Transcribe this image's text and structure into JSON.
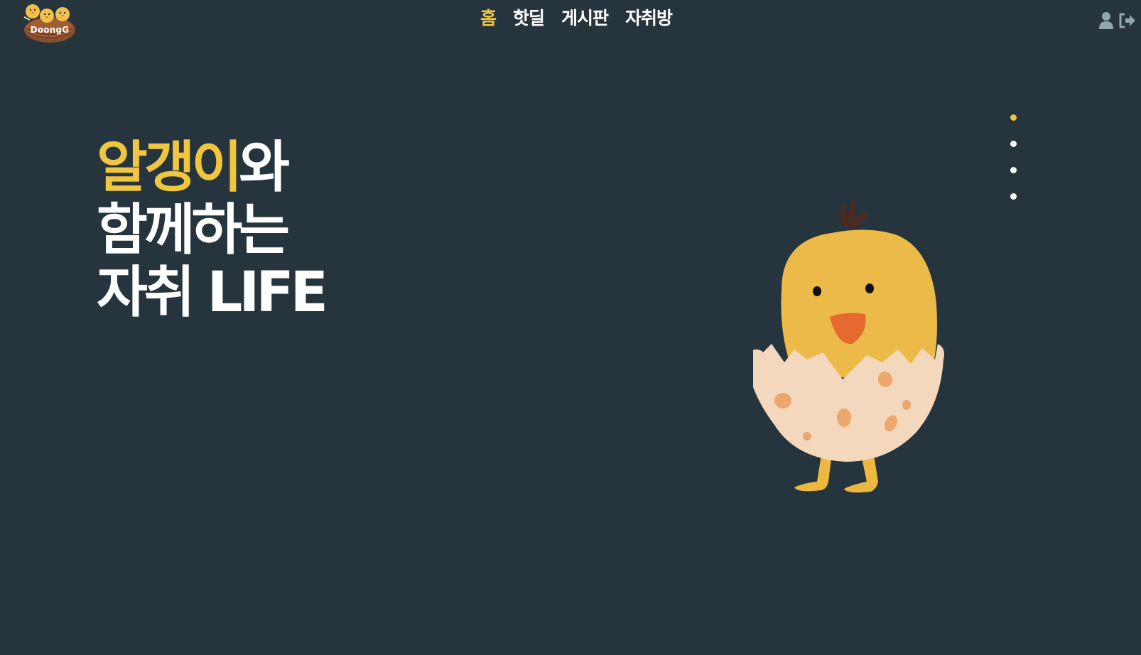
{
  "logo": {
    "text": "DoongG"
  },
  "nav": {
    "items": [
      {
        "label": "홈",
        "active": true
      },
      {
        "label": "핫딜",
        "active": false
      },
      {
        "label": "게시판",
        "active": false
      },
      {
        "label": "자취방",
        "active": false
      }
    ]
  },
  "user_actions": {
    "profile_icon": "user-icon",
    "logout_icon": "logout-icon"
  },
  "hero": {
    "line1_accent": "알갱이",
    "line1_rest": "와",
    "line2": "함께하는",
    "line3": "자취 LIFE"
  },
  "pager": {
    "count": 4,
    "active_index": 0
  },
  "colors": {
    "background": "#26353d",
    "accent": "#f0c540",
    "text": "#ffffff",
    "icon": "#8fa9ac"
  }
}
